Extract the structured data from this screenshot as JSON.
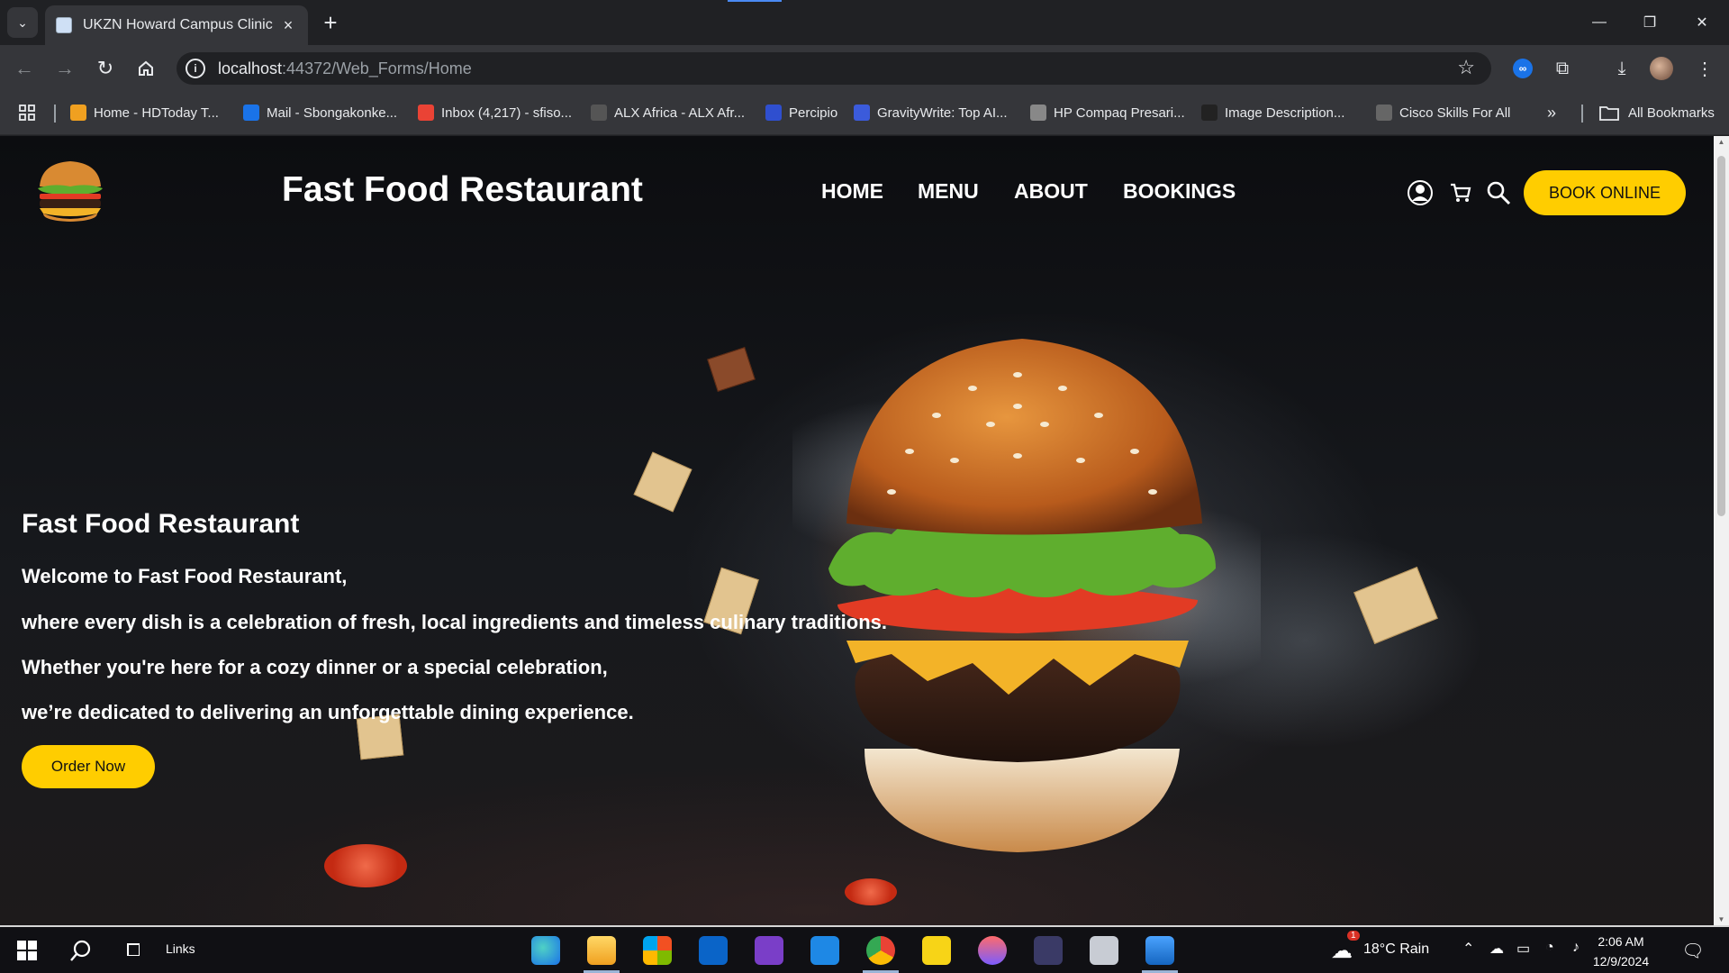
{
  "browser": {
    "tab_title": "UKZN Howard Campus Clinic",
    "url_host": "localhost",
    "url_path": ":44372/Web_Forms/Home",
    "bookmarks": [
      {
        "label": "Home - HDToday T...",
        "icon": "hd-icon",
        "color": "#f0a020"
      },
      {
        "label": "Mail - Sbongakonke...",
        "icon": "outlook-icon",
        "color": "#1a73e8"
      },
      {
        "label": "Inbox (4,217) - sfiso...",
        "icon": "gmail-icon",
        "color": "#ea4335"
      },
      {
        "label": "ALX Africa - ALX Afr...",
        "icon": "alx-icon",
        "color": "#555555"
      },
      {
        "label": "Percipio",
        "icon": "percipio-icon",
        "color": "#2f4fcf"
      },
      {
        "label": "GravityWrite: Top AI...",
        "icon": "gravitywrite-icon",
        "color": "#3b5bdb"
      },
      {
        "label": "HP Compaq Presari...",
        "icon": "globe-icon",
        "color": "#888888"
      },
      {
        "label": "Image Description...",
        "icon": "image-description-icon",
        "color": "#222222"
      },
      {
        "label": "Cisco Skills For All",
        "icon": "cisco-icon",
        "color": "#666666"
      }
    ],
    "all_bookmarks": "All Bookmarks"
  },
  "site": {
    "title": "Fast Food Restaurant",
    "nav": [
      "HOME",
      "MENU",
      "ABOUT",
      "BOOKINGS"
    ],
    "book_online": "BOOK ONLINE",
    "accent": "#ffcd00"
  },
  "hero": {
    "title": "Fast Food Restaurant",
    "lines": [
      "Welcome to Fast Food Restaurant,",
      "where every dish is a celebration of fresh, local ingredients and timeless culinary traditions.",
      "Whether you're here for a cozy dinner or a special celebration,",
      "we’re dedicated to delivering an unforgettable dining experience."
    ],
    "order_button": "Order Now"
  },
  "taskbar": {
    "links_label": "Links",
    "weather": "18°C  Rain",
    "time": "2:06 AM",
    "date": "12/9/2024",
    "weather_badge": "1"
  }
}
